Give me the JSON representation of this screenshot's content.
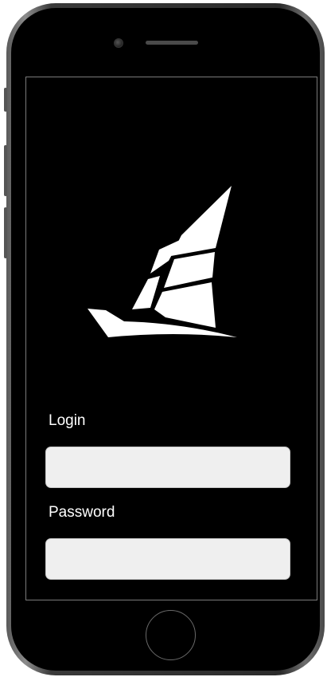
{
  "login": {
    "login_label": "Login",
    "login_value": "",
    "password_label": "Password",
    "password_value": ""
  },
  "colors": {
    "background": "#000000",
    "text": "#ffffff",
    "input_background": "#efefef",
    "logo": "#ffffff"
  },
  "icons": {
    "logo": "sailboat-logo-icon",
    "home": "home-button",
    "camera": "camera-icon",
    "speaker": "speaker-grille"
  }
}
